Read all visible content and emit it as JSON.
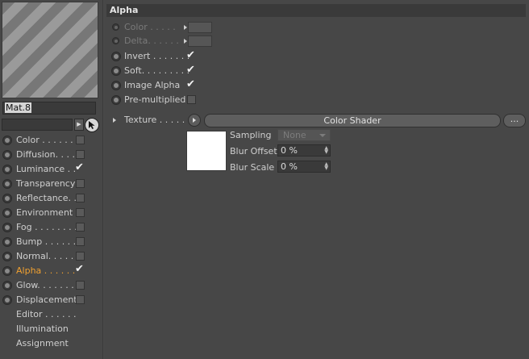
{
  "material": {
    "name": "Mat.8"
  },
  "channels": [
    {
      "label": "Color . . . . . . .",
      "checked": false,
      "active": false,
      "has_radio": true
    },
    {
      "label": "Diffusion. . . .",
      "checked": false,
      "active": false,
      "has_radio": true
    },
    {
      "label": "Luminance . .",
      "checked": true,
      "active": false,
      "has_radio": true
    },
    {
      "label": "Transparency",
      "checked": false,
      "active": false,
      "has_radio": true
    },
    {
      "label": "Reflectance. .",
      "checked": false,
      "active": false,
      "has_radio": true
    },
    {
      "label": "Environment",
      "checked": false,
      "active": false,
      "has_radio": true
    },
    {
      "label": "Fog . . . . . . . .",
      "checked": false,
      "active": false,
      "has_radio": true
    },
    {
      "label": "Bump . . . . . .",
      "checked": false,
      "active": false,
      "has_radio": true
    },
    {
      "label": "Normal. . . . .",
      "checked": false,
      "active": false,
      "has_radio": true
    },
    {
      "label": "Alpha . . . . . .",
      "checked": true,
      "active": true,
      "has_radio": true
    },
    {
      "label": "Glow. . . . . . .",
      "checked": false,
      "active": false,
      "has_radio": true
    },
    {
      "label": "Displacement",
      "checked": false,
      "active": false,
      "has_radio": true
    },
    {
      "label": "Editor . . . . . .",
      "checked": null,
      "active": false,
      "has_radio": false
    },
    {
      "label": "Illumination",
      "checked": null,
      "active": false,
      "has_radio": false
    },
    {
      "label": "Assignment",
      "checked": null,
      "active": false,
      "has_radio": false
    }
  ],
  "panel": {
    "title": "Alpha",
    "color_label": "Color . . . . .",
    "delta_label": "Delta. . . . . .",
    "invert_label": "Invert . . . . . . .",
    "soft_label": "Soft. . . . . . . . .",
    "image_alpha_label": "Image Alpha",
    "premultiplied_label": "Pre-multiplied",
    "invert_checked": true,
    "soft_checked": true,
    "image_alpha_checked": true,
    "premultiplied_checked": false,
    "check_glyph": "✔"
  },
  "texture": {
    "label": "Texture . . . . . .",
    "shader_label": "Color Shader",
    "more_label": "...",
    "sampling_label": "Sampling",
    "sampling_value": "None",
    "blur_offset_label": "Blur Offset",
    "blur_offset_value": "0 %",
    "blur_scale_label": "Blur Scale",
    "blur_scale_value": "0 %"
  },
  "icons": {
    "browse": "triangle-right-icon",
    "pick": "cursor-pick-icon",
    "spin": "spinner-arrows-icon",
    "dropdown": "chevron-down-icon"
  },
  "colors": {
    "accent_active": "#f0a030",
    "panel_bg": "#474747",
    "texture_preview": "#ffffff"
  }
}
